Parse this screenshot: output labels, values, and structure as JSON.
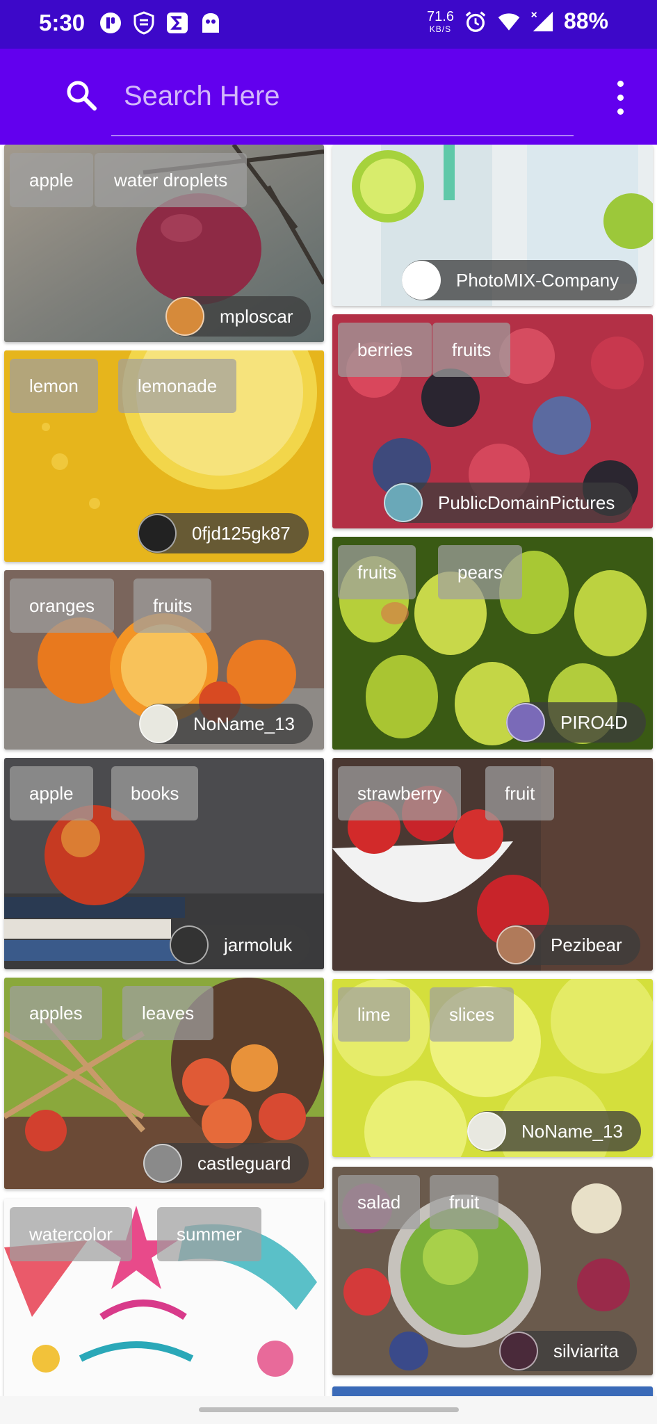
{
  "status_bar": {
    "time": "5:30",
    "net_speed_value": "71.6",
    "net_speed_unit": "KB/S",
    "battery": "88%",
    "icons": [
      "app-icon",
      "shield-icon",
      "sigma-icon",
      "ghost-icon",
      "alarm-icon",
      "wifi-icon",
      "signal-icon"
    ]
  },
  "app_bar": {
    "search_placeholder": "Search Here",
    "accent_color": "#6200ee"
  },
  "cards": [
    {
      "tags": [
        "apple",
        "water droplets"
      ],
      "author": "mploscar"
    },
    {
      "tags": [
        "",
        ""
      ],
      "author": "PhotoMIX-Company"
    },
    {
      "tags": [
        "lemon",
        "lemonade"
      ],
      "author": "0fjd125gk87"
    },
    {
      "tags": [
        "berries",
        "fruits"
      ],
      "author": "PublicDomainPictures"
    },
    {
      "tags": [
        "oranges",
        "fruits"
      ],
      "author": "NoName_13"
    },
    {
      "tags": [
        "fruits",
        "pears"
      ],
      "author": "PIRO4D"
    },
    {
      "tags": [
        "apple",
        "books"
      ],
      "author": "jarmoluk"
    },
    {
      "tags": [
        "strawberry",
        "fruit"
      ],
      "author": "Pezibear"
    },
    {
      "tags": [
        "apples",
        "leaves"
      ],
      "author": "castleguard"
    },
    {
      "tags": [
        "lime",
        "slices"
      ],
      "author": "NoName_13"
    },
    {
      "tags": [
        "watercolor",
        "summer"
      ],
      "author": ""
    },
    {
      "tags": [
        "salad",
        "fruit"
      ],
      "author": "silviarita"
    }
  ]
}
